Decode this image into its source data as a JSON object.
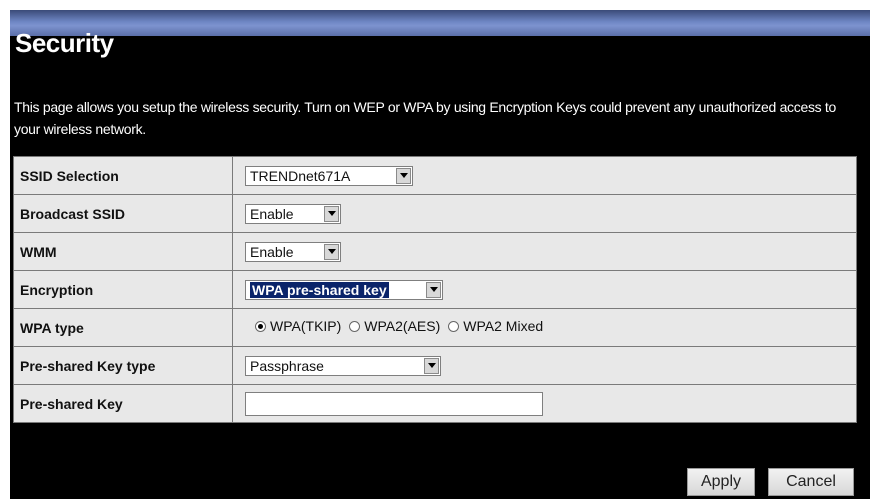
{
  "page": {
    "title": "Security",
    "description": "This page allows you setup the wireless security. Turn on WEP or WPA by using Encryption Keys could prevent any unauthorized access to your wireless network."
  },
  "form": {
    "rows": [
      {
        "label": "SSID Selection",
        "value": "TRENDnet671A"
      },
      {
        "label": "Broadcast SSID",
        "value": "Enable"
      },
      {
        "label": "WMM",
        "value": "Enable"
      },
      {
        "label": "Encryption",
        "value": "WPA pre-shared key"
      },
      {
        "label": "WPA type",
        "options": [
          "WPA(TKIP)",
          "WPA2(AES)",
          "WPA2 Mixed"
        ],
        "selected": "WPA(TKIP)"
      },
      {
        "label": "Pre-shared Key type",
        "value": "Passphrase"
      },
      {
        "label": "Pre-shared Key",
        "value": ""
      }
    ]
  },
  "buttons": {
    "apply": "Apply",
    "cancel": "Cancel"
  },
  "colors": {
    "page_background": "#000000",
    "row_background": "#e8e8e8",
    "selection_highlight": "#0a246a"
  }
}
